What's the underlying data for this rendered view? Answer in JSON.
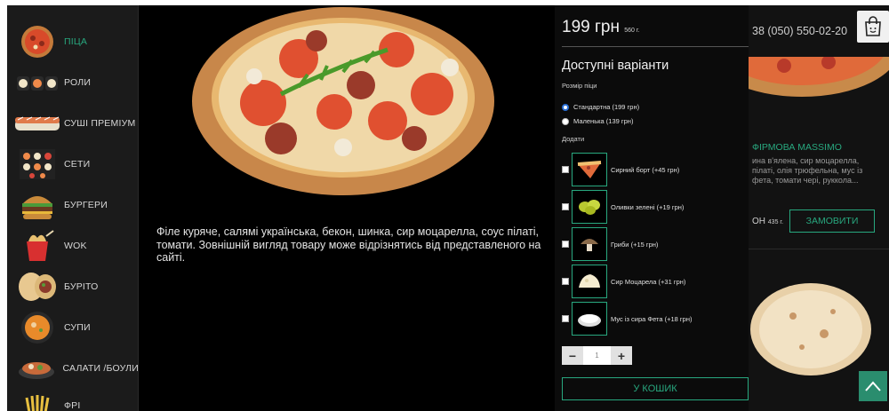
{
  "sidebar": {
    "items": [
      {
        "label": "ПІЦА",
        "icon": "pizza-icon"
      },
      {
        "label": "РОЛИ",
        "icon": "rolls-icon"
      },
      {
        "label": "СУШІ ПРЕМІУМ",
        "icon": "sushi-icon"
      },
      {
        "label": "СЕТИ",
        "icon": "sets-icon"
      },
      {
        "label": "БУРГЕРИ",
        "icon": "burger-icon"
      },
      {
        "label": "WOK",
        "icon": "wok-icon"
      },
      {
        "label": "БУРІТО",
        "icon": "burrito-icon"
      },
      {
        "label": "СУПИ",
        "icon": "soup-icon"
      },
      {
        "label": "САЛАТИ /БОУЛИ",
        "icon": "salad-icon"
      },
      {
        "label": "ФРІ",
        "icon": "fries-icon"
      }
    ],
    "active_index": 0
  },
  "header": {
    "phone": "38 (050) 550-02-20"
  },
  "background_product": {
    "name": "ФІРМОВА MASSIMO",
    "description": "ина в'ялена, сир моцарелла, пілаті, олія трюфельна, мус із фета, томати чері, руккола...",
    "price": "ОН",
    "weight": "435 г.",
    "order_label": "ЗАМОВИТИ"
  },
  "modal": {
    "price": "199 грн",
    "weight": "560 г.",
    "description": "Філе куряче, салямі українська, бекон, шинка, сир моцарелла, соус пілаті, томати. Зовнішній вигляд товару може відрізнятись від представленого на сайті.",
    "options_title": "Доступні варіанти",
    "size_label": "Розмір піци",
    "sizes": [
      {
        "label": "Стандартна (199 грн)",
        "selected": true
      },
      {
        "label": "Маленька (139 грн)",
        "selected": false
      }
    ],
    "add_label": "Додати",
    "addons": [
      {
        "label": "Сирний борт (+45 грн)",
        "icon": "cheese-crust-icon"
      },
      {
        "label": "Оливки зелені (+19 грн)",
        "icon": "green-olives-icon"
      },
      {
        "label": "Гриби (+15 грн)",
        "icon": "mushrooms-icon"
      },
      {
        "label": "Сир Моцарела (+31 грн)",
        "icon": "mozzarella-icon"
      },
      {
        "label": "Мус із сира Фета (+18 грн)",
        "icon": "feta-mousse-icon"
      }
    ],
    "quantity": "1",
    "minus": "−",
    "plus": "+",
    "cart_label": "У КОШИК"
  },
  "colors": {
    "accent": "#28a87f",
    "background": "#000000",
    "sidebar": "#1b1b1b"
  }
}
